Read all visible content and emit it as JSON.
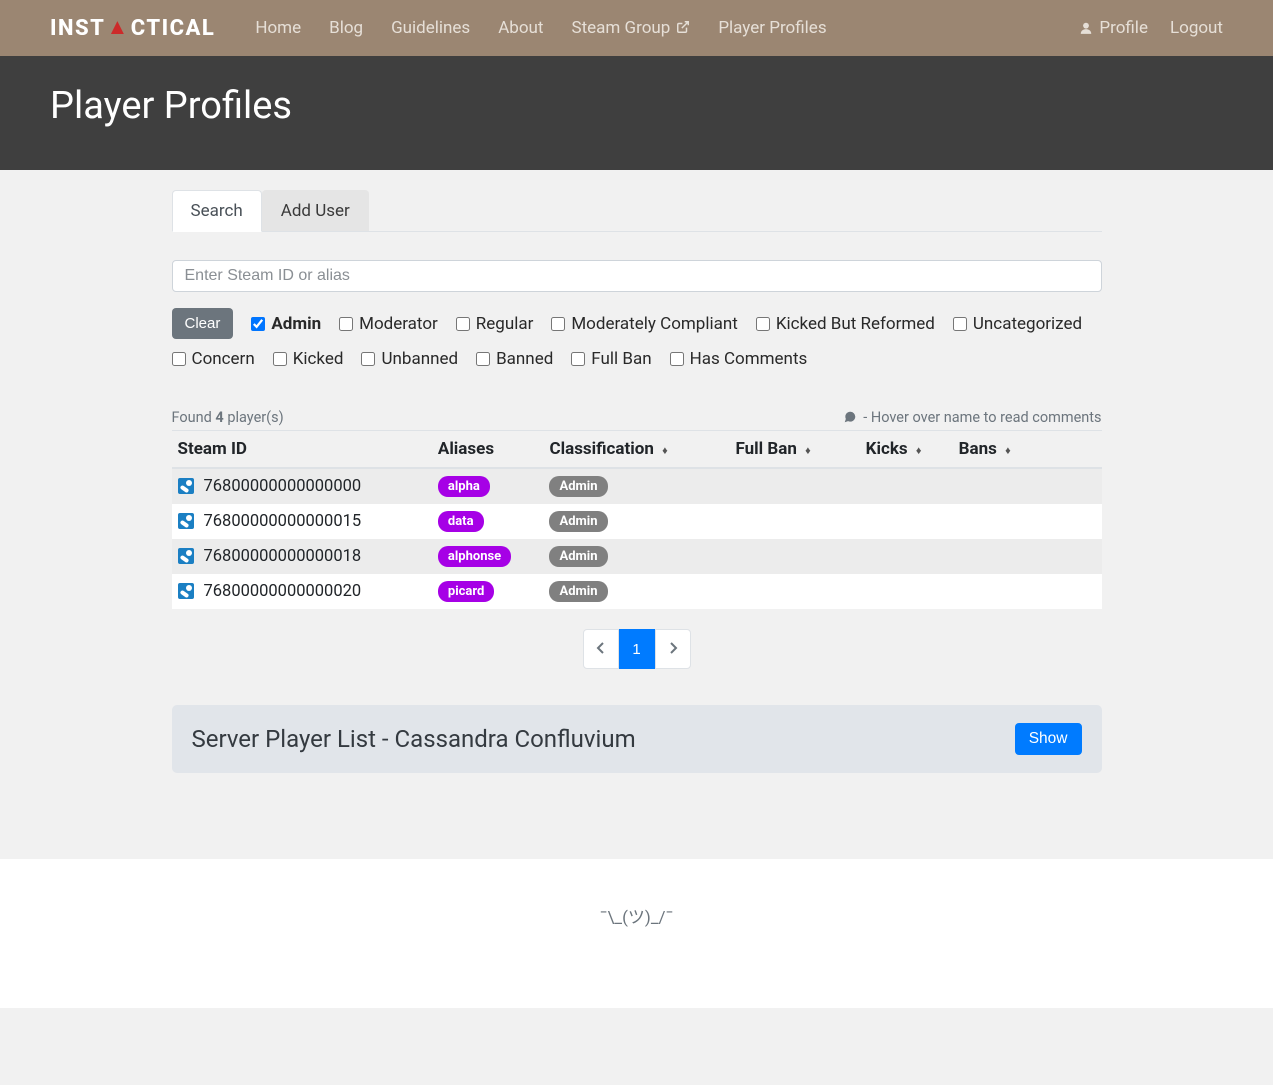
{
  "logo": {
    "pre": "INST",
    "post": "CTICAL"
  },
  "nav": {
    "items": [
      "Home",
      "Blog",
      "Guidelines",
      "About",
      "Steam Group",
      "Player Profiles"
    ],
    "profile": "Profile",
    "logout": "Logout"
  },
  "page_title": "Player Profiles",
  "tabs": {
    "search": "Search",
    "add_user": "Add User"
  },
  "search": {
    "placeholder": "Enter Steam ID or alias"
  },
  "filters": {
    "clear": "Clear",
    "items": [
      {
        "label": "Admin",
        "checked": true
      },
      {
        "label": "Moderator",
        "checked": false
      },
      {
        "label": "Regular",
        "checked": false
      },
      {
        "label": "Moderately Compliant",
        "checked": false
      },
      {
        "label": "Kicked But Reformed",
        "checked": false
      },
      {
        "label": "Uncategorized",
        "checked": false
      },
      {
        "label": "Concern",
        "checked": false
      },
      {
        "label": "Kicked",
        "checked": false
      },
      {
        "label": "Unbanned",
        "checked": false
      },
      {
        "label": "Banned",
        "checked": false
      },
      {
        "label": "Full Ban",
        "checked": false
      },
      {
        "label": "Has Comments",
        "checked": false
      }
    ]
  },
  "results": {
    "found_pre": "Found ",
    "count": "4",
    "found_post": " player(s)",
    "hint": "- Hover over name to read comments"
  },
  "table": {
    "headers": {
      "steam_id": "Steam ID",
      "aliases": "Aliases",
      "classification": "Classification",
      "full_ban": "Full Ban",
      "kicks": "Kicks",
      "bans": "Bans"
    },
    "rows": [
      {
        "steam_id": "76800000000000000",
        "alias": "alpha",
        "classification": "Admin"
      },
      {
        "steam_id": "76800000000000015",
        "alias": "data",
        "classification": "Admin"
      },
      {
        "steam_id": "76800000000000018",
        "alias": "alphonse",
        "classification": "Admin"
      },
      {
        "steam_id": "76800000000000020",
        "alias": "picard",
        "classification": "Admin"
      }
    ]
  },
  "pagination": {
    "current": "1"
  },
  "server_panel": {
    "title": "Server Player List - Cassandra Confluvium",
    "show": "Show"
  },
  "footer": "¯\\_(ツ)_/¯"
}
